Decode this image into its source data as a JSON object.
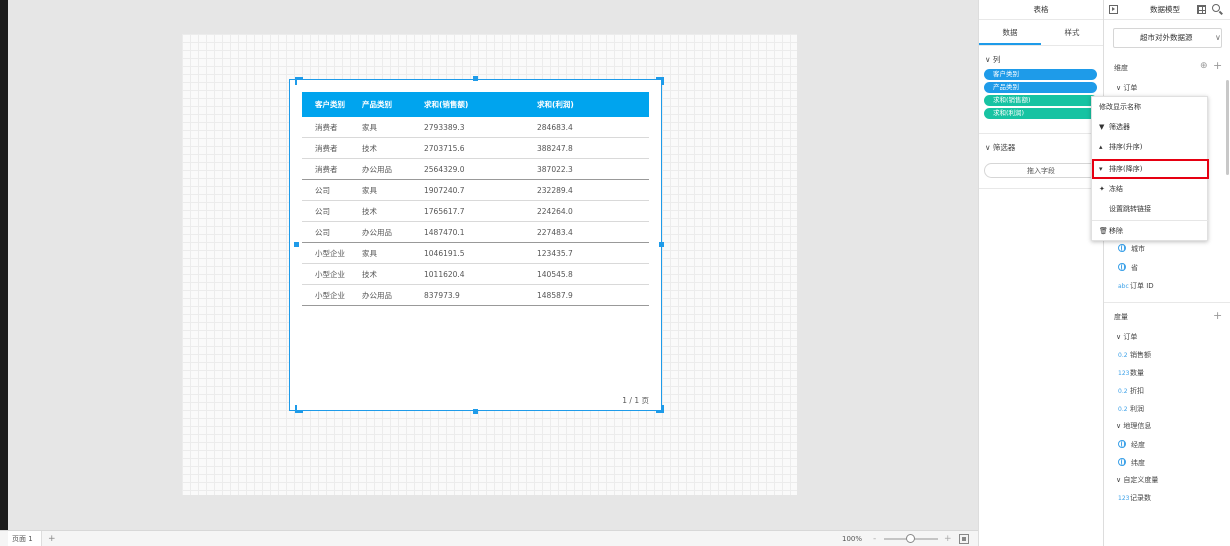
{
  "canvas": {
    "table": {
      "headers": [
        "客户类别",
        "产品类别",
        "求和(销售额)",
        "求和(利润)"
      ],
      "rows": [
        [
          "消费者",
          "家具",
          "2793389.3",
          "284683.4"
        ],
        [
          "消费者",
          "技术",
          "2703715.6",
          "388247.8"
        ],
        [
          "消费者",
          "办公用品",
          "2564329.0",
          "387022.3"
        ],
        [
          "公司",
          "家具",
          "1907240.7",
          "232289.4"
        ],
        [
          "公司",
          "技术",
          "1765617.7",
          "224264.0"
        ],
        [
          "公司",
          "办公用品",
          "1487470.1",
          "227483.4"
        ],
        [
          "小型企业",
          "家具",
          "1046191.5",
          "123435.7"
        ],
        [
          "小型企业",
          "技术",
          "1011620.4",
          "140545.8"
        ],
        [
          "小型企业",
          "办公用品",
          "837973.9",
          "148587.9"
        ]
      ],
      "pager": "1 / 1 页"
    }
  },
  "bottom_bar": {
    "page_tab": "页面 1",
    "add_page": "+",
    "zoom": "100%",
    "zoom_minus": "-",
    "zoom_plus": "+"
  },
  "mid_panel": {
    "title": "表格",
    "tabs": [
      "数据",
      "样式"
    ],
    "columns_label": "∨ 列",
    "columns": [
      {
        "label": "客户类别",
        "color": "#1e9be9"
      },
      {
        "label": "产品类别",
        "color": "#1e9be9"
      },
      {
        "label": "求和(销售额)",
        "color": "#17c3a2"
      },
      {
        "label": "求和(利润)",
        "color": "#17c3a2"
      }
    ],
    "filter_label": "∨ 筛选器",
    "drop_zone": "拖入字段"
  },
  "right_panel": {
    "title": "数据模型",
    "data_source": "超市对外数据源",
    "dimension_label": "维度",
    "dimension_group": "∨ 订单",
    "dimension_items": [
      {
        "icon": "globe",
        "label": "城市"
      },
      {
        "icon": "globe",
        "label": "省"
      },
      {
        "icon": "abc",
        "label": "订单 ID"
      }
    ],
    "measure_label": "度量",
    "measure_group": "∨ 订单",
    "measure_items": [
      {
        "icon": "0.2",
        "label": "销售额"
      },
      {
        "icon": "123",
        "label": "数量"
      },
      {
        "icon": "0.2",
        "label": "折扣"
      },
      {
        "icon": "0.2",
        "label": "利润"
      }
    ],
    "geo_group": "∨ 地理信息",
    "geo_items": [
      "经度",
      "纬度"
    ],
    "custom_group": "∨ 自定义度量",
    "custom_items": [
      {
        "icon": "123",
        "label": "记录数"
      }
    ]
  },
  "context_menu": {
    "items": [
      {
        "icon": "",
        "label": "修改显示名称"
      },
      {
        "icon": "▼",
        "label": "筛选器"
      },
      {
        "icon": "▴",
        "label": "排序(升序)"
      },
      {
        "icon": "▾",
        "label": "排序(降序)"
      },
      {
        "icon": "✦",
        "label": "冻结"
      },
      {
        "icon": "",
        "label": "设置跳转链接"
      },
      {
        "icon": "🗑",
        "label": "移除"
      }
    ],
    "highlight_color": "#e60012"
  },
  "colors": {
    "accent": "#1e9be9",
    "header_blue": "#00a4ee",
    "teal": "#17c3a2"
  }
}
